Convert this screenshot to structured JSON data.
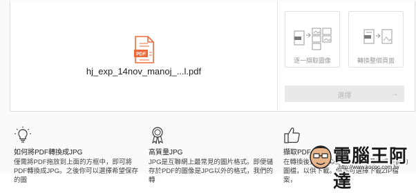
{
  "file": {
    "name": "hj_exp_14nov_manoj_...l.pdf",
    "icon_label": "PDF"
  },
  "options": [
    {
      "label": "逐一擷取圖像",
      "icon": "extract-images-icon"
    },
    {
      "label": "轉換整個頁面",
      "icon": "convert-page-icon"
    }
  ],
  "select_button": {
    "label": "選擇",
    "arrow": "→"
  },
  "info": [
    {
      "icon": "lightbulb-icon",
      "title": "如何將PDF轉換成JPG",
      "desc": "僅需將PDF拖放到上面的方框中，即可將PDF轉換成JPG。之後你可以選擇希望保存的圖"
    },
    {
      "icon": "award-ribbon-icon",
      "title": "高質量JPG",
      "desc": "JPG是互聯網上最常見的圖片格式。即便儲存於PDF的圖像是JPG以外的格式，我們的轉"
    },
    {
      "icon": "thumbs-up-icon",
      "title": "擷取PDF",
      "desc": "在轉換後，你可以選擇下載單獨的或整個的圖檔，以供下載。你亦可選擇下載ZIP檔案，"
    }
  ],
  "watermark": {
    "text": "電腦王阿達",
    "url": "http://www.kocpc.com.tw"
  },
  "colors": {
    "pdf_orange": "#ef6a3a",
    "button_bg": "#e9e9e9",
    "border": "#dcdcdc"
  }
}
